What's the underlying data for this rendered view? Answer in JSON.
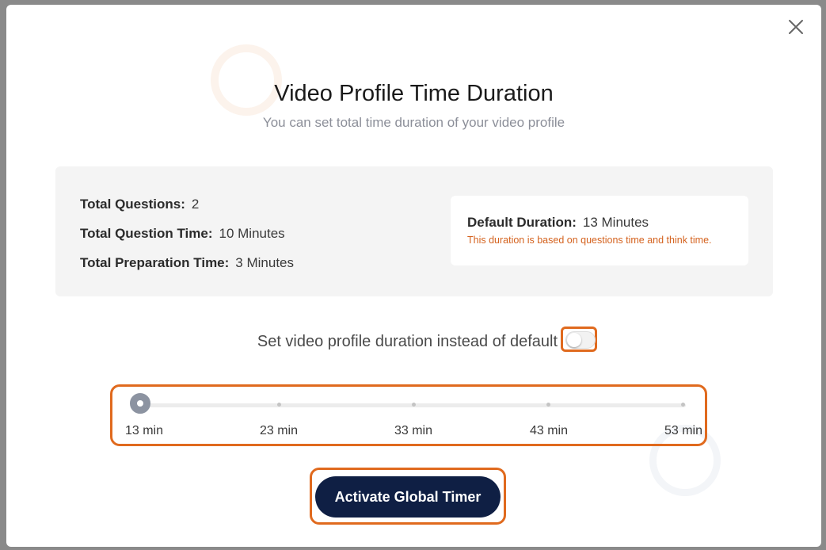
{
  "modal": {
    "title": "Video Profile Time Duration",
    "subtitle": "You can set total time duration of your video profile",
    "close_icon": "close-icon"
  },
  "summary": {
    "total_questions_label": "Total Questions:",
    "total_questions_value": "2",
    "total_question_time_label": "Total Question Time:",
    "total_question_time_value": "10 Minutes",
    "total_preparation_time_label": "Total Preparation Time:",
    "total_preparation_time_value": "3 Minutes"
  },
  "default_duration": {
    "label": "Default Duration:",
    "value": "13 Minutes",
    "note": "This duration is based on questions time and think time."
  },
  "custom_duration": {
    "toggle_label": "Set video profile duration instead of default",
    "toggle_on": false
  },
  "slider": {
    "ticks": [
      "13 min",
      "23 min",
      "33 min",
      "43 min",
      "53 min"
    ],
    "selected": "13 min"
  },
  "actions": {
    "activate_label": "Activate Global Timer"
  },
  "colors": {
    "highlight": "#e06a1e",
    "primary_button": "#0f1f44",
    "note_text": "#d4621e"
  }
}
